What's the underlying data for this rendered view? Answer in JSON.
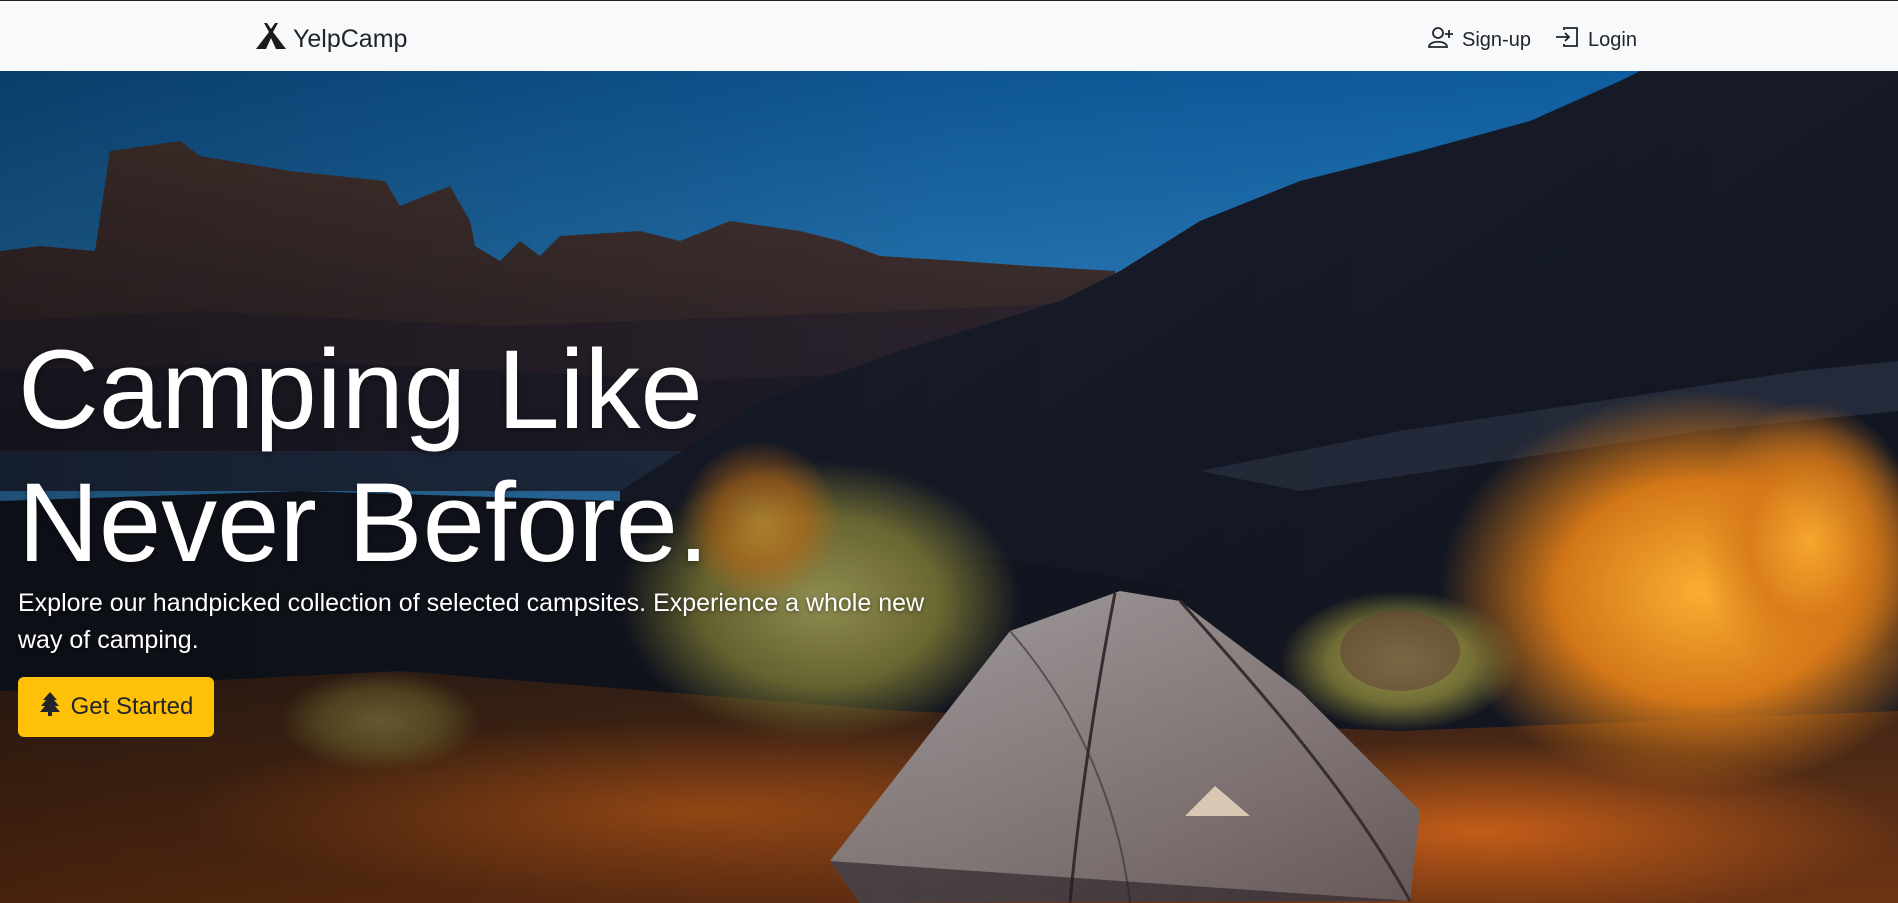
{
  "navbar": {
    "brand_label": "YelpCamp",
    "brand_icon": "campground-icon",
    "signup_label": "Sign-up",
    "signup_icon": "person-plus-icon",
    "login_label": "Login",
    "login_icon": "login-arrow-icon"
  },
  "hero": {
    "headline_line1": "Camping Like",
    "headline_line2": "Never Before.",
    "lead": "Explore our handpicked collection of selected campsites. Experience a whole new way of camping.",
    "cta_label": "Get Started",
    "cta_icon": "tree-icon"
  },
  "colors": {
    "navbar_bg": "#f8f9fa",
    "cta_bg": "#ffc107",
    "text_dark": "#212529",
    "text_light": "#ffffff"
  }
}
